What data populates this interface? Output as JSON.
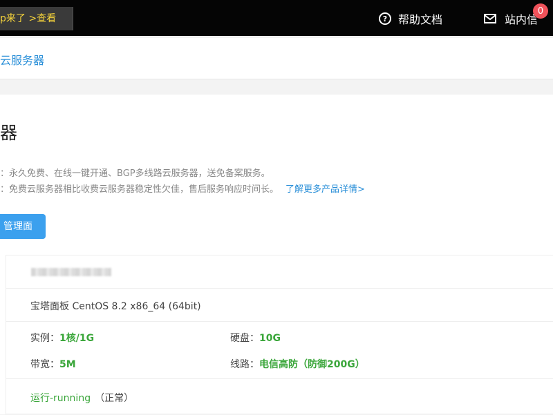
{
  "topbar": {
    "promo_text": "p来了  >查看",
    "help_label": "帮助文档",
    "messages_label": "站内信",
    "message_count": "0"
  },
  "breadcrumb": {
    "current": "云服务器"
  },
  "main": {
    "title": "器",
    "desc_line1": "：永久免费、在线一键开通、BGP多线路云服务器，送免备案服务。",
    "desc_line2": "：免费云服务器相比收费云服务器稳定性欠佳，售后服务响应时间长。",
    "more_link": "了解更多产品详情>",
    "panel_button": "管理面板"
  },
  "server": {
    "os_image": "宝塔面板 CentOS 8.2 x86_64 (64bit)",
    "instance_label": "实例：",
    "instance_value": "1核/1G",
    "disk_label": "硬盘：",
    "disk_value": "10G",
    "bandwidth_label": "带宽：",
    "bandwidth_value": "5M",
    "line_label": "线路：",
    "line_value": "电信高防（防御200G）",
    "status_value": "运行-running",
    "status_note": "（正常）"
  },
  "colors": {
    "topbar_bg": "#050505",
    "accent_blue": "#2a8fd8",
    "button_blue": "#3ba0ee",
    "value_green": "#3aa63a",
    "badge_red": "#f0525a",
    "promo_yellow": "#f5d33b"
  },
  "icons": {
    "help": "question-circle-icon",
    "messages": "envelope-icon"
  }
}
